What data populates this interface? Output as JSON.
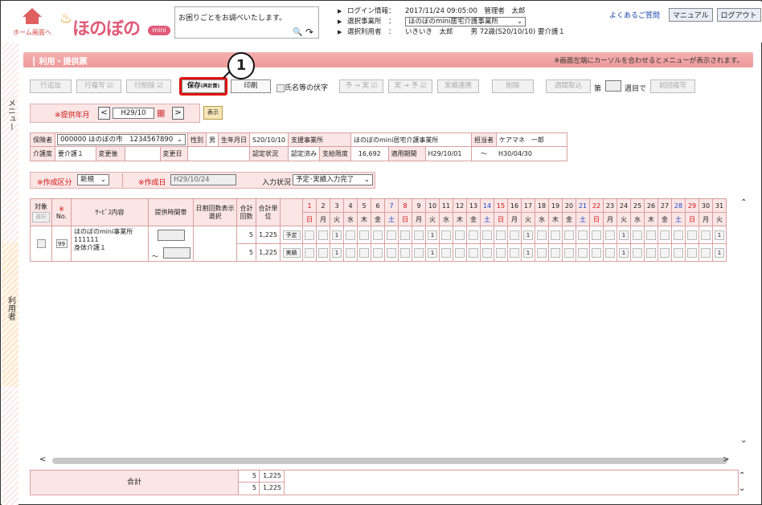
{
  "header": {
    "home_label": "ホーム画面へ",
    "logo_text": "ほのぼの",
    "logo_mini": "mini",
    "help_text": "お困りごとをお調べいたします。",
    "login_label": "ログイン情報：",
    "login_value": "2017/11/24 09:05:00　管理者　太郎",
    "office_label": "選択事業所　：",
    "office_value": "ほのぼのmini居宅介護事業所",
    "user_label": "選択利用者　：",
    "user_value": "いきいき　太郎",
    "user_detail": "男 72歳(S20/10/10) 要介護１",
    "faq": "よくあるご質問",
    "manual": "マニュアル",
    "logout": "ログアウト"
  },
  "sidebar": {
    "menu": "メニュー",
    "user": "利用者"
  },
  "title": "利用・提供票",
  "notice": "※画面左端にカーソルを合わせるとメニューが表示されます。",
  "toolbar": {
    "row_add": "行追加",
    "row_copy": "行複写",
    "row_delete": "行削除",
    "save": "保存",
    "save_sub": "(再計算)",
    "print": "印刷",
    "name_ext": "氏名等の伏字",
    "plan_to_actual": "予 → 実",
    "actual_to_plan": "実 → 予",
    "actual_link": "実績連携",
    "delete": "削除",
    "weekly": "週間取込",
    "week_prefix": "第",
    "week_suffix": "週目で",
    "prev_copy": "前回複写"
  },
  "callout": "1",
  "period": {
    "label": "※提供年月",
    "value": "H29/10",
    "show": "表示"
  },
  "info": {
    "insurer_label": "保険者",
    "insurer_value": "000000 ほのぼの市　1234567890",
    "sex_label": "性別",
    "sex_value": "男",
    "birth_label": "生年月日",
    "birth_value": "S20/10/10",
    "support_label": "支援事業所",
    "support_value": "ほのぼのmini居宅介護事業所",
    "cm_label": "担当者",
    "cm_value": "ケアマネ　一郎",
    "care_label": "介護度",
    "care_value": "要介護１",
    "changed_label": "変更後",
    "change_date_label": "変更日",
    "cert_label": "認定状況",
    "cert_value": "認定済み",
    "limit_label": "支給限度",
    "limit_value": "16,692",
    "applied_label": "適用期間",
    "applied_from": "H29/10/01",
    "applied_sep": "～",
    "applied_to": "H30/04/30"
  },
  "create": {
    "kind_label": "※作成区分",
    "kind_value": "新規",
    "date_label": "※作成日",
    "date_value": "H29/10/24",
    "status_label": "入力状況",
    "status_value": "予定･実績入力完了"
  },
  "grid": {
    "h_target": "対象",
    "h_select": "選択",
    "h_no": "No.",
    "h_mark": "※",
    "h_service": "ｻｰﾋﾞｽ内容",
    "h_time": "提供時間帯",
    "h_split": "日割回数表示選択",
    "h_count": "合計回数",
    "h_units": "合計単位",
    "days": [
      "1",
      "2",
      "3",
      "4",
      "5",
      "6",
      "7",
      "8",
      "9",
      "10",
      "11",
      "12",
      "13",
      "14",
      "15",
      "16",
      "17",
      "18",
      "19",
      "20",
      "21",
      "22",
      "23",
      "24",
      "25",
      "26",
      "27",
      "28",
      "29",
      "30",
      "31"
    ],
    "weekdays": [
      "日",
      "月",
      "火",
      "水",
      "木",
      "金",
      "土",
      "日",
      "月",
      "火",
      "水",
      "木",
      "金",
      "土",
      "日",
      "月",
      "火",
      "水",
      "木",
      "金",
      "土",
      "日",
      "月",
      "火",
      "水",
      "木",
      "金",
      "土",
      "日",
      "月",
      "火"
    ],
    "row": {
      "no": "99",
      "service": "ほのぼのmini事業所",
      "code": "111111",
      "service_name": "身体介護１",
      "tilde": "～",
      "plan_count": "5",
      "plan_units": "1,225",
      "plan_label": "予定",
      "actual_count": "5",
      "actual_units": "1,225",
      "actual_label": "実績",
      "marks": [
        "",
        "",
        "1",
        "",
        "",
        "",
        "",
        "",
        "",
        "1",
        "",
        "",
        "",
        "",
        "",
        "",
        "1",
        "",
        "",
        "",
        "",
        "",
        "",
        "1",
        "",
        "",
        "",
        "",
        "",
        "",
        "1"
      ]
    }
  },
  "total": {
    "label": "合計",
    "plan_count": "5",
    "plan_units": "1,225",
    "actual_count": "5",
    "actual_units": "1,225"
  },
  "colors": {
    "accent": "#e05a78",
    "header_pink": "#f4b0b0",
    "highlight": "#e01010"
  }
}
